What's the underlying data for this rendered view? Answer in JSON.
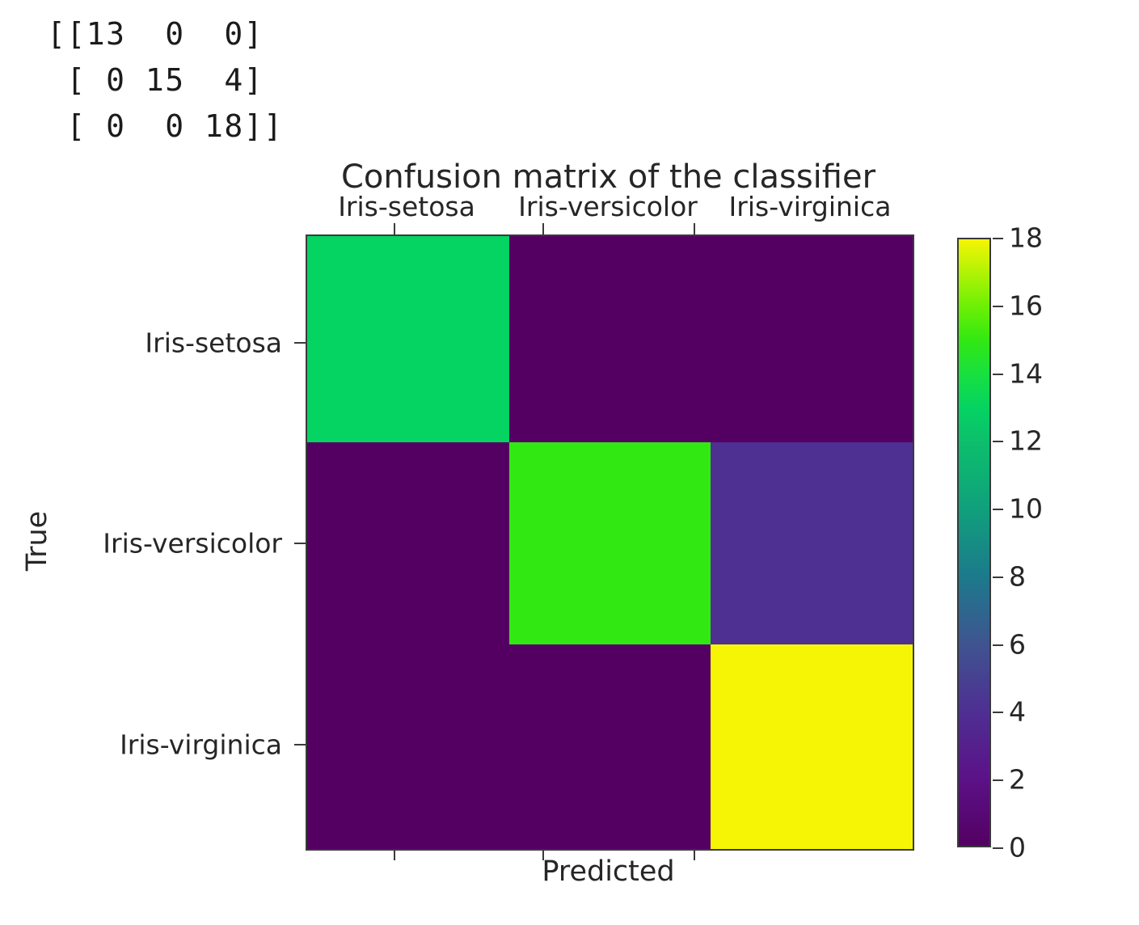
{
  "console": {
    "text": "[[13  0  0]\n [ 0 15  4]\n [ 0  0 18]]"
  },
  "chart_data": {
    "type": "heatmap",
    "title": "Confusion matrix of the classifier",
    "xlabel": "Predicted",
    "ylabel": "True",
    "categories_x": [
      "Iris-setosa",
      "Iris-versicolor",
      "Iris-virginica"
    ],
    "categories_y": [
      "Iris-setosa",
      "Iris-versicolor",
      "Iris-virginica"
    ],
    "matrix": [
      [
        13,
        0,
        0
      ],
      [
        0,
        15,
        4
      ],
      [
        0,
        0,
        18
      ]
    ],
    "cell_colors": [
      [
        "#05d362",
        "#540063",
        "#540063"
      ],
      [
        "#540063",
        "#32e812",
        "#4e2f92"
      ],
      [
        "#540063",
        "#540063",
        "#f5f505"
      ]
    ],
    "colorbar": {
      "vmin": 0,
      "vmax": 18,
      "ticks": [
        18,
        16,
        14,
        12,
        10,
        8,
        6,
        4,
        2,
        0
      ],
      "position": "right",
      "colormap": "viridis",
      "gradient_stops": [
        {
          "value": 0,
          "color": "#540063"
        },
        {
          "value": 2,
          "color": "#5b1287"
        },
        {
          "value": 4,
          "color": "#4e2f92"
        },
        {
          "value": 6,
          "color": "#3f5490"
        },
        {
          "value": 8,
          "color": "#1c7a8c"
        },
        {
          "value": 10,
          "color": "#10a07c"
        },
        {
          "value": 12,
          "color": "#0cbf6c"
        },
        {
          "value": 13,
          "color": "#05d362"
        },
        {
          "value": 14,
          "color": "#18e03f"
        },
        {
          "value": 15,
          "color": "#32e812"
        },
        {
          "value": 16,
          "color": "#6cf005"
        },
        {
          "value": 18,
          "color": "#f5f505"
        }
      ]
    },
    "grid": false,
    "legend": "colorbar"
  }
}
